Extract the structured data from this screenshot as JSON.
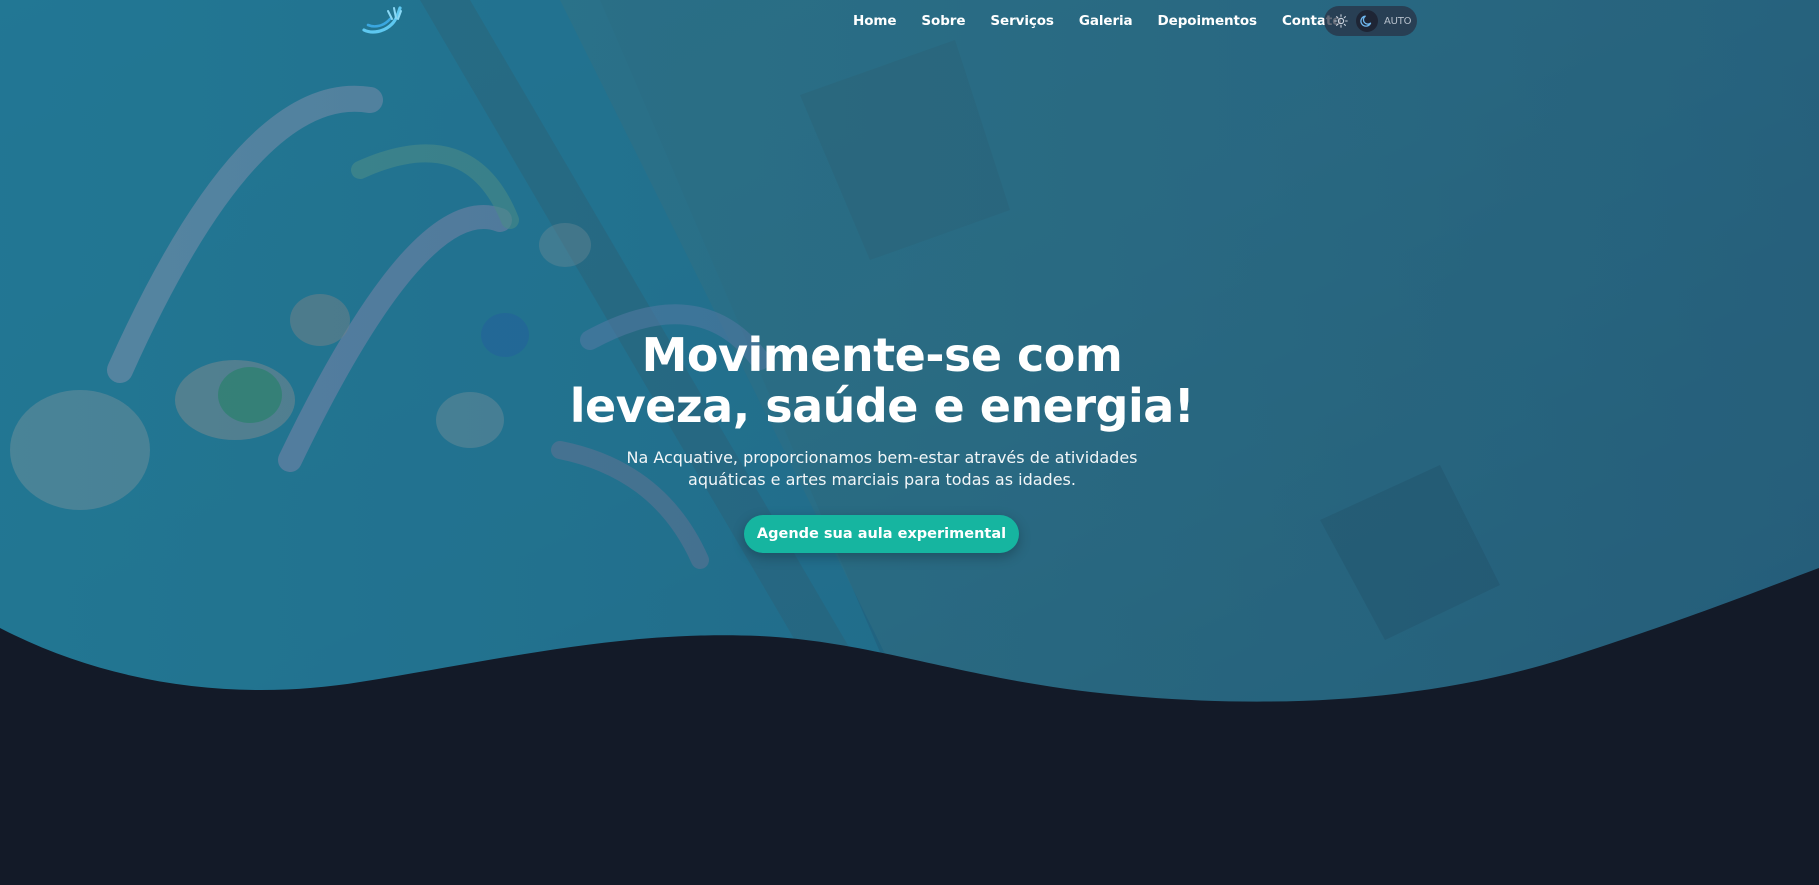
{
  "brand": {
    "logo_icon": "wave-splash-icon"
  },
  "nav": {
    "items": [
      {
        "label": "Home"
      },
      {
        "label": "Sobre"
      },
      {
        "label": "Serviços"
      },
      {
        "label": "Galeria"
      },
      {
        "label": "Depoimentos"
      },
      {
        "label": "Contato"
      }
    ]
  },
  "theme_toggle": {
    "options": [
      "sun-icon",
      "moon-icon"
    ],
    "selected": "moon-icon",
    "label": "AUTO"
  },
  "hero": {
    "headline_line1": "Movimente-se com",
    "headline_line2": "leveza, saúde e energia!",
    "subtitle_line1": "Na Acquative, proporcionamos bem-estar através de atividades",
    "subtitle_line2": "aquáticas e artes marciais para todas as idades.",
    "cta_label": "Agende sua aula experimental"
  },
  "colors": {
    "accent": "#16b5a0",
    "page_background": "#131a28",
    "hero_overlay": "#1f5f7a"
  }
}
